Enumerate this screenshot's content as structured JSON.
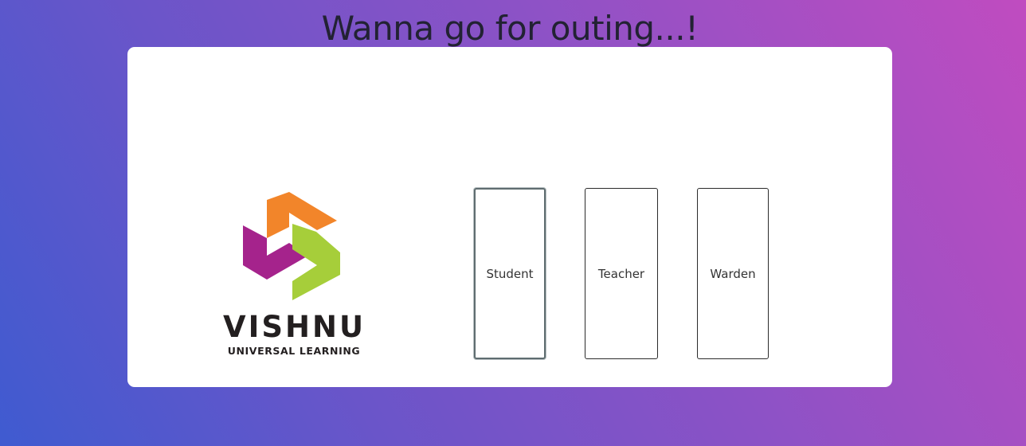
{
  "header": {
    "title": "Wanna go for outing...!"
  },
  "logo": {
    "name": "VISHNU",
    "tagline": "UNIVERSAL LEARNING",
    "colors": {
      "orange": "#f2852a",
      "purple": "#a5238c",
      "green": "#a6ce3a"
    }
  },
  "roles": [
    {
      "label": "Student",
      "focused": true
    },
    {
      "label": "Teacher",
      "focused": false
    },
    {
      "label": "Warden",
      "focused": false
    }
  ],
  "theme": {
    "gradient_start": "#3f5bd0",
    "gradient_end": "#c04cc0",
    "card_background": "#ffffff"
  }
}
